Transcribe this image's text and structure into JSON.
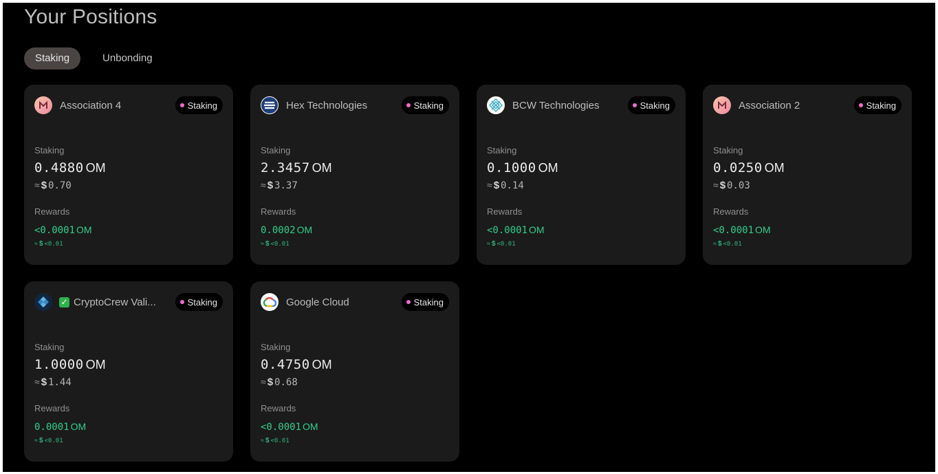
{
  "page": {
    "title": "Your Positions"
  },
  "tabs": [
    {
      "label": "Staking",
      "active": true
    },
    {
      "label": "Unbonding",
      "active": false
    }
  ],
  "labels": {
    "staking": "Staking",
    "rewards": "Rewards",
    "approx": "≈",
    "dollar": "$"
  },
  "colors": {
    "accent_dot": "#f06bd0",
    "reward_green": "#32cf8c",
    "card_bg": "#1b1b1b",
    "tab_active_bg": "#4a4542"
  },
  "positions": [
    {
      "validator": "Association 4",
      "icon": "mantra-m-logo-icon",
      "status": "Staking",
      "staked_amount": "0.4880",
      "staked_unit": "OM",
      "staked_usd": "0.70",
      "reward_amount": "<0.0001",
      "reward_unit": "OM",
      "reward_usd": "<0.01"
    },
    {
      "validator": "Hex Technologies",
      "icon": "hex-technologies-logo-icon",
      "status": "Staking",
      "staked_amount": "2.3457",
      "staked_unit": "OM",
      "staked_usd": "3.37",
      "reward_amount": "0.0002",
      "reward_unit": "OM",
      "reward_usd": "<0.01"
    },
    {
      "validator": "BCW Technologies",
      "icon": "bcw-technologies-logo-icon",
      "status": "Staking",
      "staked_amount": "0.1000",
      "staked_unit": "OM",
      "staked_usd": "0.14",
      "reward_amount": "<0.0001",
      "reward_unit": "OM",
      "reward_usd": "<0.01"
    },
    {
      "validator": "Association 2",
      "icon": "mantra-m-logo-icon",
      "status": "Staking",
      "staked_amount": "0.0250",
      "staked_unit": "OM",
      "staked_usd": "0.03",
      "reward_amount": "<0.0001",
      "reward_unit": "OM",
      "reward_usd": "<0.01"
    },
    {
      "validator": "CryptoCrew Vali...",
      "icon": "cryptocrew-logo-icon",
      "verified_icon": "verified-check-icon",
      "status": "Staking",
      "staked_amount": "1.0000",
      "staked_unit": "OM",
      "staked_usd": "1.44",
      "reward_amount": "0.0001",
      "reward_unit": "OM",
      "reward_usd": "<0.01"
    },
    {
      "validator": "Google Cloud",
      "icon": "google-cloud-logo-icon",
      "status": "Staking",
      "staked_amount": "0.4750",
      "staked_unit": "OM",
      "staked_usd": "0.68",
      "reward_amount": "<0.0001",
      "reward_unit": "OM",
      "reward_usd": "<0.01"
    }
  ]
}
